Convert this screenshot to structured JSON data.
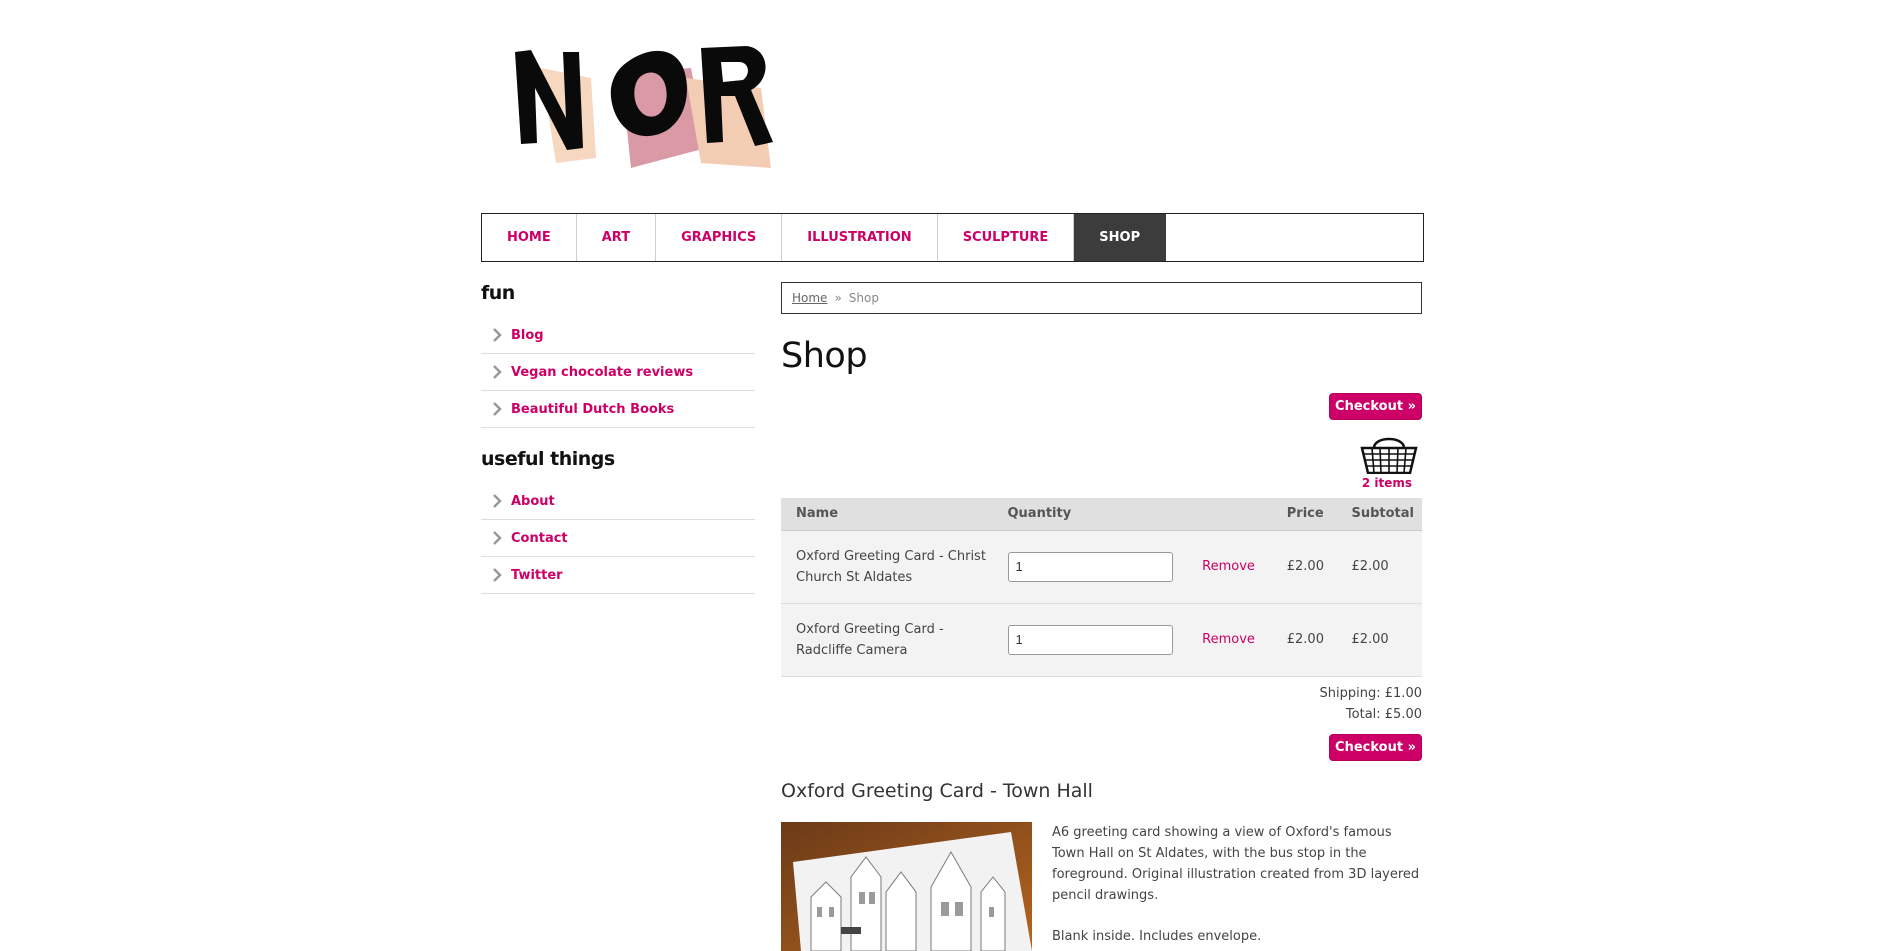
{
  "logo": {
    "text": "NOR"
  },
  "nav": {
    "items": [
      {
        "label": "HOME"
      },
      {
        "label": "ART"
      },
      {
        "label": "GRAPHICS"
      },
      {
        "label": "ILLUSTRATION"
      },
      {
        "label": "SCULPTURE"
      },
      {
        "label": "SHOP"
      }
    ]
  },
  "sidebar": {
    "sections": [
      {
        "heading": "fun",
        "items": [
          "Blog",
          "Vegan chocolate reviews",
          "Beautiful Dutch Books"
        ]
      },
      {
        "heading": "useful things",
        "items": [
          "About",
          "Contact",
          "Twitter"
        ]
      }
    ]
  },
  "breadcrumb": {
    "home": "Home",
    "separator": "»",
    "current": "Shop"
  },
  "page_title": "Shop",
  "checkout_label": "Checkout »",
  "basket": {
    "count_label": "2 items"
  },
  "cart": {
    "headers": {
      "name": "Name",
      "quantity": "Quantity",
      "remove": "",
      "price": "Price",
      "subtotal": "Subtotal"
    },
    "rows": [
      {
        "name": "Oxford Greeting Card - Christ Church St Aldates",
        "quantity": "1",
        "remove": "Remove",
        "price": "£2.00",
        "subtotal": "£2.00"
      },
      {
        "name": "Oxford Greeting Card - Radcliffe Camera",
        "quantity": "1",
        "remove": "Remove",
        "price": "£2.00",
        "subtotal": "£2.00"
      }
    ],
    "shipping": "Shipping: £1.00",
    "total": "Total: £5.00"
  },
  "product": {
    "title": "Oxford Greeting Card - Town Hall",
    "description": [
      "A6 greeting card showing a view of Oxford's famous Town Hall on St Aldates, with the bus stop in the foreground. Original illustration created from 3D layered pencil drawings.",
      "Blank inside. Includes envelope."
    ]
  },
  "colors": {
    "accent": "#cc0066",
    "nav_active_bg": "#3c3c3c"
  }
}
